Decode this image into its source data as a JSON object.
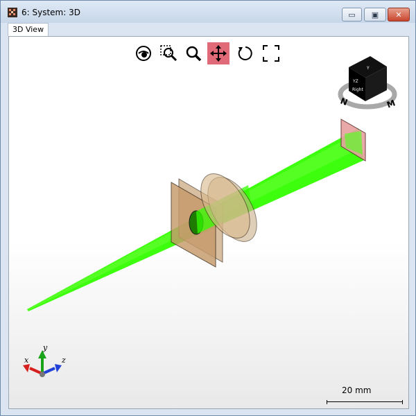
{
  "window": {
    "title": "6: System: 3D"
  },
  "titlebar_buttons": {
    "minimize": "▭",
    "maximize": "▣",
    "close": "✕"
  },
  "tabs": [
    {
      "label": "3D View"
    }
  ],
  "toolbar": {
    "tools": [
      {
        "name": "eye-icon"
      },
      {
        "name": "zoom-window-icon"
      },
      {
        "name": "zoom-icon"
      },
      {
        "name": "pan-icon",
        "active": true
      },
      {
        "name": "rotate-icon"
      },
      {
        "name": "fit-icon"
      }
    ],
    "active_color": "#e06a78"
  },
  "view_cube": {
    "face_labels": [
      "Y",
      "YZ",
      "Right"
    ],
    "compass": [
      "N",
      "M"
    ]
  },
  "axes_triad": {
    "x": "x",
    "y": "y",
    "z": "z"
  },
  "scale_bar": {
    "label": "20 mm"
  },
  "colors": {
    "ray": "#33ff00",
    "lens": "#d9b98c",
    "detector": "#e7a0a0"
  }
}
